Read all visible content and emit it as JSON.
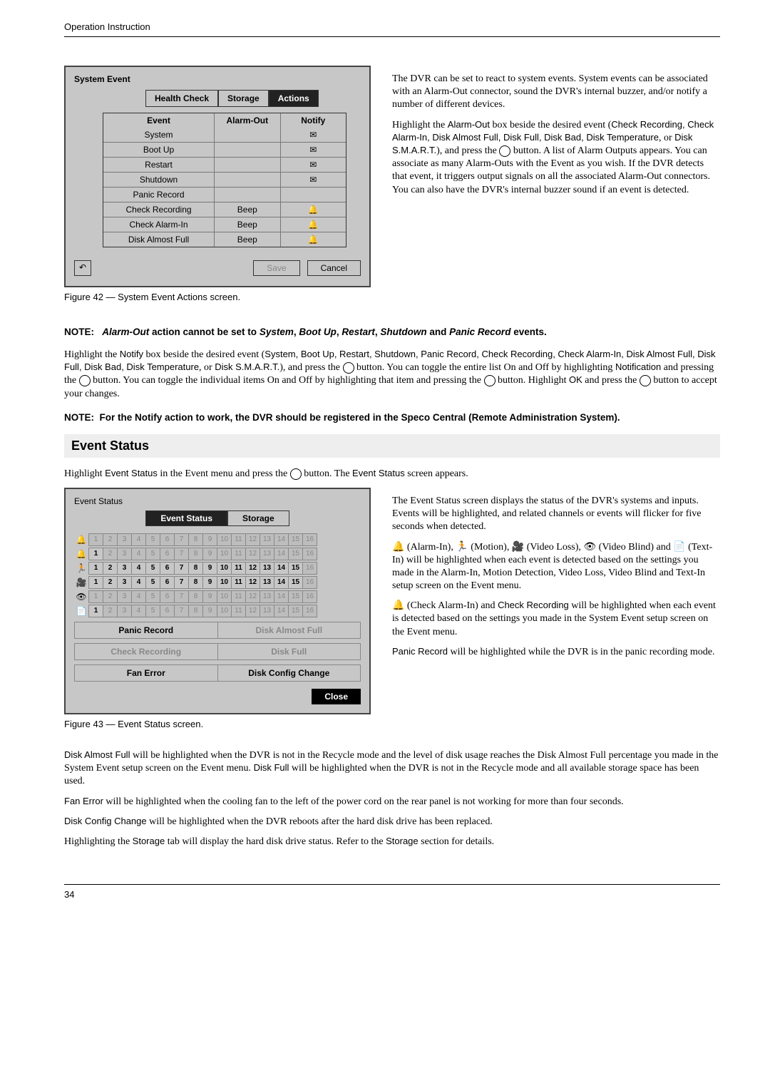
{
  "header": "Operation Instruction",
  "page_number": "34",
  "enter_glyph": "⊘",
  "sys_panel": {
    "title": "System Event",
    "tabs": [
      "Health Check",
      "Storage",
      "Actions"
    ],
    "active_tab": 2,
    "columns": [
      "Event",
      "Alarm-Out",
      "Notify"
    ],
    "rows": [
      {
        "event": "System",
        "alarm": "",
        "notify": "✉"
      },
      {
        "event": "Boot Up",
        "alarm": "",
        "notify": "✉"
      },
      {
        "event": "Restart",
        "alarm": "",
        "notify": "✉"
      },
      {
        "event": "Shutdown",
        "alarm": "",
        "notify": "✉"
      },
      {
        "event": "Panic Record",
        "alarm": "",
        "notify": ""
      },
      {
        "event": "Check Recording",
        "alarm": "Beep",
        "notify": "🔔"
      },
      {
        "event": "Check Alarm-In",
        "alarm": "Beep",
        "notify": "🔔"
      },
      {
        "event": "Disk Almost Full",
        "alarm": "Beep",
        "notify": "🔔"
      }
    ],
    "save": "Save",
    "cancel": "Cancel",
    "back": "↶"
  },
  "fig42": "Figure 42 — System Event Actions screen.",
  "para_right1": "The DVR can be set to react to system events.  System events can be associated with an Alarm-Out connector, sound the DVR's internal buzzer, and/or notify a number of different devices.",
  "para_right2_a": "Highlight the ",
  "para_right2_alarmout": "Alarm-Out",
  "para_right2_b": " box beside the desired event (",
  "para_right2_list": "Check Recording, Check Alarm-In, Disk Almost Full, Disk Full, Disk Bad, Disk Temperature",
  "para_right2_c": ", or ",
  "para_right2_smart": "Disk S.M.A.R.T.",
  "para_right2_d": "), and press the ",
  "para_right2_e": " button.  A list of Alarm Outputs appears.  You can associate as many Alarm-Outs with the Event as you wish. If the DVR detects that event, it triggers output signals on all the associated Alarm-Out connectors.  You can also have the DVR's internal buzzer sound if an event is detected.",
  "note1_label": "NOTE:",
  "note1_body": "Alarm-Out action cannot be set to System, Boot Up, Restart, Shutdown and Panic Record events.",
  "note1_parts": {
    "a": "Alarm-Out",
    "b": " action cannot be set to ",
    "c": "System",
    "d": ", ",
    "e": "Boot Up",
    "f": ", ",
    "g": "Restart",
    "h": ", ",
    "i": "Shutdown",
    "j": " and ",
    "k": "Panic Record",
    "l": " events."
  },
  "para3_a": "Highlight the ",
  "para3_notify": "Notify",
  "para3_b": " box beside the desired event (",
  "para3_list": "System, Boot Up, Restart, Shutdown, Panic Record, Check Recording, Check Alarm-In, Disk Almost Full, Disk Full, Disk Bad, Disk Temperature",
  "para3_c": ", or ",
  "para3_smart": "Disk S.M.A.R.T.",
  "para3_d": "), and press the ",
  "para3_e": " button.  You can toggle the entire list On and Off by highlighting ",
  "para3_not": "Notification",
  "para3_f": " and pressing the ",
  "para3_g": " button. You can toggle the individual items On and Off by highlighting that item and pressing the ",
  "para3_h": " button.  Highlight ",
  "para3_ok": "OK",
  "para3_i": " and press the ",
  "para3_j": " button to accept your changes.",
  "note2_label": "NOTE:",
  "note2_body": "For the Notify action to work, the DVR should be registered in the Speco Central (Remote Administration System).",
  "section_title": "Event Status",
  "para4_a": "Highlight ",
  "para4_es": "Event Status",
  "para4_b": " in the Event menu and press the ",
  "para4_c": " button.  The ",
  "para4_es2": "Event Status",
  "para4_d": " screen appears.",
  "es_panel": {
    "title": "Event Status",
    "tabs": [
      "Event Status",
      "Storage"
    ],
    "active": 0,
    "strips": [
      {
        "icon": "🔔",
        "on": []
      },
      {
        "icon": "🔔",
        "on": [
          1
        ]
      },
      {
        "icon": "🏃",
        "on": [
          1,
          2,
          3,
          4,
          5,
          6,
          7,
          8,
          9,
          10,
          11,
          12,
          13,
          14,
          15
        ]
      },
      {
        "icon": "🎥",
        "on": [
          1,
          2,
          3,
          4,
          5,
          6,
          7,
          8,
          9,
          10,
          11,
          12,
          13,
          14,
          15
        ]
      },
      {
        "icon": "👁",
        "on": []
      },
      {
        "icon": "📄",
        "on": [
          1
        ]
      }
    ],
    "pairs": [
      [
        "Panic Record",
        "Disk Almost Full"
      ],
      [
        "Check Recording",
        "Disk Full"
      ],
      [
        "Fan Error",
        "Disk Config Change"
      ]
    ],
    "pair_dims": [
      [
        false,
        true
      ],
      [
        true,
        true
      ],
      [
        false,
        false
      ]
    ],
    "close": "Close"
  },
  "fig43": "Figure 43 — Event Status screen.",
  "para_r1": "The Event Status screen displays the status of the DVR's systems and inputs.  Events will be highlighted, and related channels or events will flicker for five seconds when detected.",
  "para_r2_a": "🔔 (Alarm-In), 🏃 (Motion), 🎥 (Video Loss), 👁 (Video Blind) and 📄 (Text-In) will be highlighted when each event is detected based on the settings you made in the Alarm-In, Motion Detection, Video Loss, Video Blind and Text-In setup screen on the Event menu.",
  "para_r3_a": "🔔 (Check Alarm-In) and ",
  "para_r3_cr": "Check Recording",
  "para_r3_b": " will be highlighted when each event is detected based on the settings you made in the System Event setup screen on the Event menu.",
  "para_r4_a": "Panic Record",
  "para_r4_b": " will be highlighted while the DVR is in the panic recording mode.",
  "para_b1_a": "Disk Almost Full",
  "para_b1_b": " will be highlighted when the DVR is not in the Recycle mode and the level of disk usage reaches the Disk Almost Full percentage you made in the System Event setup screen on the Event menu.  ",
  "para_b1_c": "Disk Full",
  "para_b1_d": " will be highlighted when the DVR is not in the Recycle mode and all available storage space has been used.",
  "para_b2_a": "Fan Error",
  "para_b2_b": " will be highlighted when the cooling fan to the left of the power cord on the rear panel is not working for more than four seconds.",
  "para_b3_a": "Disk Config Change",
  "para_b3_b": " will be highlighted when the DVR reboots after the hard disk drive has been replaced.",
  "para_b4_a": "Highlighting the ",
  "para_b4_s": "Storage",
  "para_b4_b": " tab will display the hard disk drive status.  Refer to the ",
  "para_b4_s2": "Storage",
  "para_b4_c": " section for details."
}
